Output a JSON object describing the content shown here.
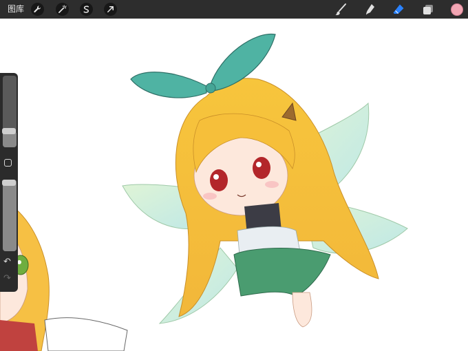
{
  "toolbar": {
    "gallery_label": "图库",
    "left_tools": [
      {
        "icon": "wrench-icon"
      },
      {
        "icon": "magic-wand-icon"
      },
      {
        "icon": "selection-icon"
      },
      {
        "icon": "transform-arrow-icon"
      }
    ],
    "right_tools": [
      {
        "icon": "brush-icon"
      },
      {
        "icon": "smudge-icon"
      },
      {
        "icon": "eraser-icon",
        "active": true
      },
      {
        "icon": "layers-icon"
      }
    ],
    "current_color": "#f2a6b3",
    "active_tool_color": "#2a82ff"
  },
  "sidebar": {
    "brush_size_level": 0.2,
    "opacity_level": 1.0,
    "undo_icon": "undo-arrow-icon",
    "redo_icon": "redo-arrow-icon"
  },
  "canvas": {
    "background": "#ffffff"
  }
}
